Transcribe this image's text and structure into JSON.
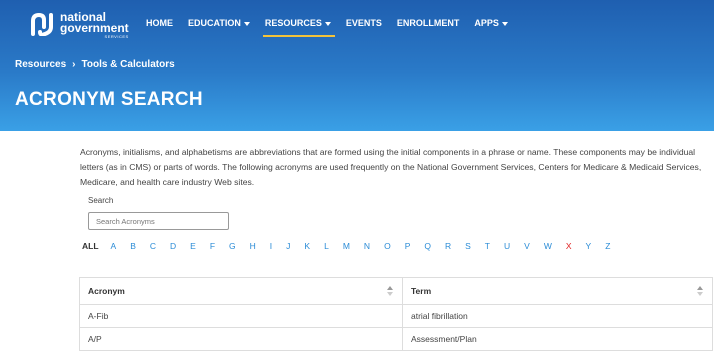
{
  "logo": {
    "line1": "national",
    "line2": "government",
    "line3": "SERVICES",
    "color": "#ffffff"
  },
  "nav": [
    {
      "label": "HOME",
      "dropdown": false,
      "active": false
    },
    {
      "label": "EDUCATION",
      "dropdown": true,
      "active": false
    },
    {
      "label": "RESOURCES",
      "dropdown": true,
      "active": true
    },
    {
      "label": "EVENTS",
      "dropdown": false,
      "active": false
    },
    {
      "label": "ENROLLMENT",
      "dropdown": false,
      "active": false
    },
    {
      "label": "APPS",
      "dropdown": true,
      "active": false
    }
  ],
  "breadcrumb": {
    "items": [
      "Resources",
      "Tools & Calculators"
    ],
    "separator": "›"
  },
  "page": {
    "title": "ACRONYM SEARCH"
  },
  "intro": "Acronyms, initialisms, and alphabetisms are abbreviations that are formed using the initial components in a phrase or name. These components may be individual letters (as in CMS) or parts of words. The following acronyms are used frequently on the National Government Services, Centers for Medicare & Medicaid Services, Medicare, and health care industry Web sites.",
  "search": {
    "label": "Search",
    "placeholder": "Search Acronyms",
    "value": ""
  },
  "letters": [
    "ALL",
    "A",
    "B",
    "C",
    "D",
    "E",
    "F",
    "G",
    "H",
    "I",
    "J",
    "K",
    "L",
    "M",
    "N",
    "O",
    "P",
    "Q",
    "R",
    "S",
    "T",
    "U",
    "V",
    "W",
    "X",
    "Y",
    "Z"
  ],
  "letters_highlight": "X",
  "table": {
    "headers": [
      "Acronym",
      "Term"
    ],
    "rows": [
      [
        "A-Fib",
        "atrial fibrillation"
      ],
      [
        "A/P",
        "Assessment/Plan"
      ]
    ]
  },
  "colors": {
    "accent": "#2a8bd6",
    "highlight": "#e02020",
    "nav_underline": "#f3c33a",
    "hero_top": "#1f5fb0",
    "hero_bottom": "#3aa0e6"
  }
}
